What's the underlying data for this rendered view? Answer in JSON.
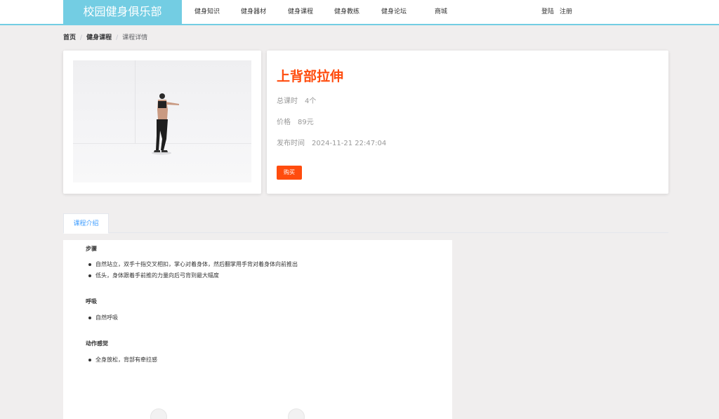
{
  "header": {
    "logo": "校园健身俱乐部",
    "nav": [
      "健身知识",
      "健身器材",
      "健身课程",
      "健身教练",
      "健身论坛",
      "商城"
    ],
    "login": "登陆",
    "register": "注册"
  },
  "breadcrumb": {
    "home": "首页",
    "courses": "健身课程",
    "current": "课程详情"
  },
  "course": {
    "title": "上背部拉伸",
    "total_lessons_label": "总课时",
    "total_lessons_value": "4个",
    "price_label": "价格",
    "price_value": "89元",
    "publish_label": "发布时间",
    "publish_value": "2024-11-21 22:47:04",
    "buy_label": "购买"
  },
  "tabs": {
    "intro": "课程介绍"
  },
  "content": {
    "steps_title": "步骤",
    "steps": [
      "自然站立，双手十指交叉相扣，掌心对着身体，然后翻掌用手背对着身体向前推出",
      "低头，身体跟着手前推的力量向后弓背到最大幅度"
    ],
    "breath_title": "呼吸",
    "breath": [
      "自然呼吸"
    ],
    "feel_title": "动作感觉",
    "feel": [
      "全身放松，背部有牵拉感"
    ]
  },
  "colors": {
    "header_accent": "#73cde3",
    "title_accent": "#ff4c0e",
    "tab_active": "#409eff"
  }
}
